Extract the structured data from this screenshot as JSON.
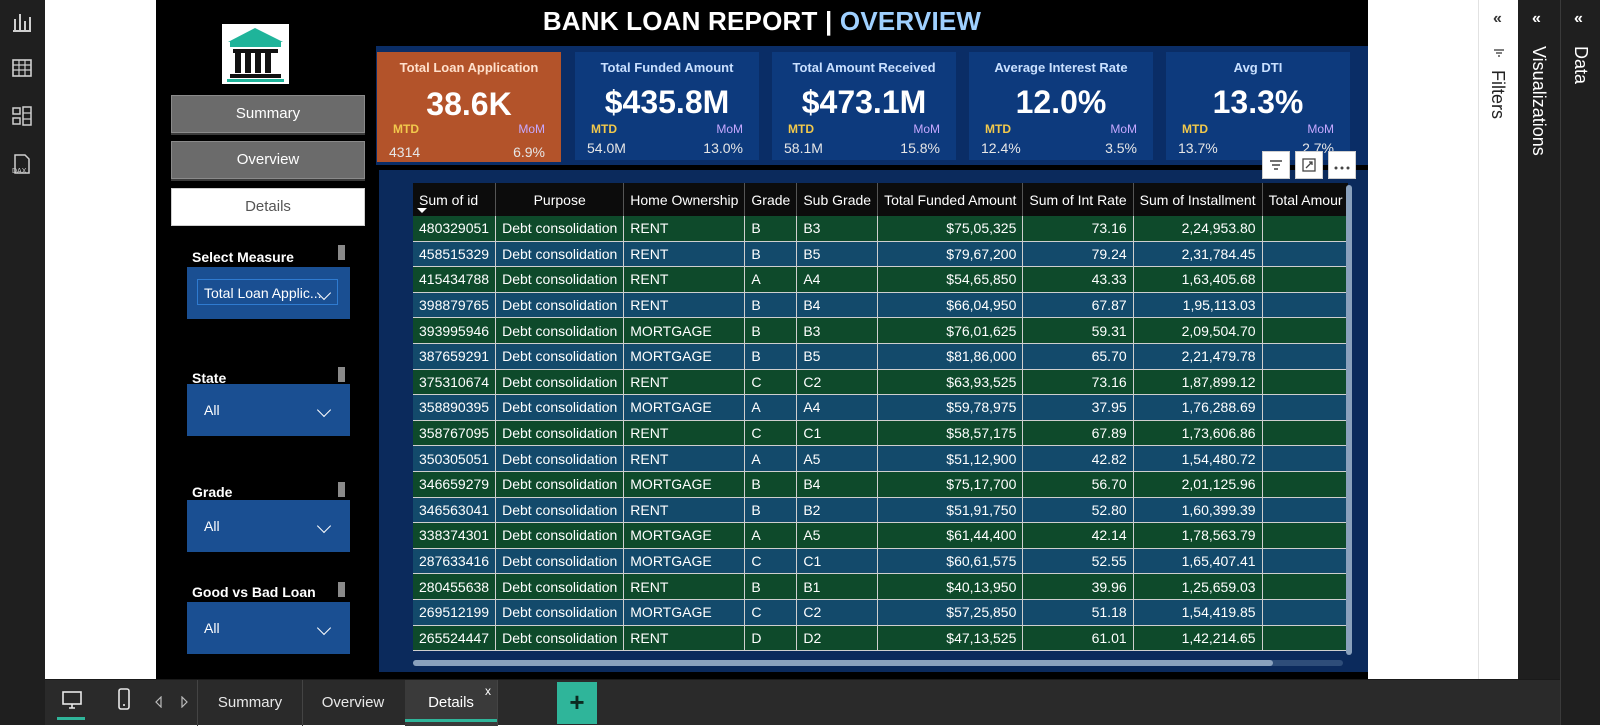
{
  "report": {
    "title_main": "BANK LOAN REPORT | ",
    "title_accent": "OVERVIEW"
  },
  "nav": {
    "summary": "Summary",
    "overview": "Overview",
    "details": "Details"
  },
  "slicers": [
    {
      "label": "Select Measure",
      "value": "Total Loan Applic..."
    },
    {
      "label": "State",
      "value": "All"
    },
    {
      "label": "Grade",
      "value": "All"
    },
    {
      "label": "Good vs Bad Loan",
      "value": "All"
    }
  ],
  "kpis": [
    {
      "title": "Total Loan Application",
      "value": "38.6K",
      "mtd_label": "MTD",
      "mom_label": "MoM",
      "mtd": "4314",
      "mom": "6.9%"
    },
    {
      "title": "Total Funded Amount",
      "value": "$435.8M",
      "mtd_label": "MTD",
      "mom_label": "MoM",
      "mtd": "54.0M",
      "mom": "13.0%"
    },
    {
      "title": "Total Amount Received",
      "value": "$473.1M",
      "mtd_label": "MTD",
      "mom_label": "MoM",
      "mtd": "58.1M",
      "mom": "15.8%"
    },
    {
      "title": "Average Interest Rate",
      "value": "12.0%",
      "mtd_label": "MTD",
      "mom_label": "MoM",
      "mtd": "12.4%",
      "mom": "3.5%"
    },
    {
      "title": "Avg DTI",
      "value": "13.3%",
      "mtd_label": "MTD",
      "mom_label": "MoM",
      "mtd": "13.7%",
      "mom": "2.7%"
    }
  ],
  "table": {
    "columns": [
      "Sum of id",
      "Purpose",
      "Home Ownership",
      "Grade",
      "Sub Grade",
      "Total Funded Amount",
      "Sum of Int Rate",
      "Sum of Installment",
      "Total Amour"
    ],
    "rows": [
      [
        "480329051",
        "Debt consolidation",
        "RENT",
        "B",
        "B3",
        "$75,05,325",
        "73.16",
        "2,24,953.80",
        ""
      ],
      [
        "458515329",
        "Debt consolidation",
        "RENT",
        "B",
        "B5",
        "$79,67,200",
        "79.24",
        "2,31,784.45",
        ""
      ],
      [
        "415434788",
        "Debt consolidation",
        "RENT",
        "A",
        "A4",
        "$54,65,850",
        "43.33",
        "1,63,405.68",
        ""
      ],
      [
        "398879765",
        "Debt consolidation",
        "RENT",
        "B",
        "B4",
        "$66,04,950",
        "67.87",
        "1,95,113.03",
        ""
      ],
      [
        "393995946",
        "Debt consolidation",
        "MORTGAGE",
        "B",
        "B3",
        "$76,01,625",
        "59.31",
        "2,09,504.70",
        ""
      ],
      [
        "387659291",
        "Debt consolidation",
        "MORTGAGE",
        "B",
        "B5",
        "$81,86,000",
        "65.70",
        "2,21,479.78",
        ""
      ],
      [
        "375310674",
        "Debt consolidation",
        "RENT",
        "C",
        "C2",
        "$63,93,525",
        "73.16",
        "1,87,899.12",
        ""
      ],
      [
        "358890395",
        "Debt consolidation",
        "MORTGAGE",
        "A",
        "A4",
        "$59,78,975",
        "37.95",
        "1,76,288.69",
        ""
      ],
      [
        "358767095",
        "Debt consolidation",
        "RENT",
        "C",
        "C1",
        "$58,57,175",
        "67.89",
        "1,73,606.86",
        ""
      ],
      [
        "350305051",
        "Debt consolidation",
        "RENT",
        "A",
        "A5",
        "$51,12,900",
        "42.82",
        "1,54,480.72",
        ""
      ],
      [
        "346659279",
        "Debt consolidation",
        "MORTGAGE",
        "B",
        "B4",
        "$75,17,700",
        "56.70",
        "2,01,125.96",
        ""
      ],
      [
        "346563041",
        "Debt consolidation",
        "RENT",
        "B",
        "B2",
        "$51,91,750",
        "52.80",
        "1,60,399.39",
        ""
      ],
      [
        "338374301",
        "Debt consolidation",
        "MORTGAGE",
        "A",
        "A5",
        "$61,44,400",
        "42.14",
        "1,78,563.79",
        ""
      ],
      [
        "287633416",
        "Debt consolidation",
        "MORTGAGE",
        "C",
        "C1",
        "$60,61,575",
        "52.55",
        "1,65,407.41",
        ""
      ],
      [
        "280455638",
        "Debt consolidation",
        "RENT",
        "B",
        "B1",
        "$40,13,950",
        "39.96",
        "1,25,659.03",
        ""
      ],
      [
        "269512199",
        "Debt consolidation",
        "MORTGAGE",
        "C",
        "C2",
        "$57,25,850",
        "51.18",
        "1,54,419.85",
        ""
      ],
      [
        "265524447",
        "Debt consolidation",
        "RENT",
        "D",
        "D2",
        "$47,13,525",
        "61.01",
        "1,42,214.65",
        ""
      ]
    ]
  },
  "panes": {
    "filters": "Filters",
    "visualizations": "Visualizations",
    "data": "Data"
  },
  "tabs": {
    "summary": "Summary",
    "overview": "Overview",
    "details": "Details",
    "close": "x",
    "add": "+"
  },
  "colors": {
    "accent_title": "#9fd0ff",
    "kpi_first": "#b3532a",
    "kpi_blue": "#0d3a7d",
    "row_green": "#0e4a2b",
    "row_blue": "#134a6b",
    "tab_accent": "#2fb59a"
  },
  "icons": [
    "report-view-icon",
    "table-view-icon",
    "model-view-icon",
    "dax-query-icon",
    "filter-icon",
    "focus-mode-icon",
    "more-options-icon",
    "desktop-icon",
    "phone-icon",
    "prev-page-icon",
    "next-page-icon",
    "collapse-icon"
  ]
}
